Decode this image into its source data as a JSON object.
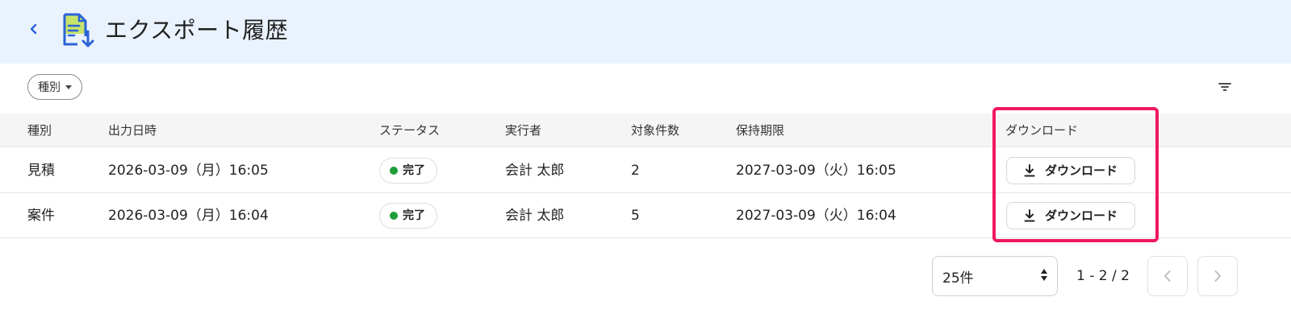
{
  "header": {
    "title": "エクスポート履歴",
    "back_icon": "chevron-left-icon",
    "page_icon": "document-download-icon"
  },
  "filter_chip": {
    "label": "種別"
  },
  "columns": [
    "種別",
    "出力日時",
    "ステータス",
    "実行者",
    "対象件数",
    "保持期限",
    "ダウンロード"
  ],
  "rows": [
    {
      "type": "見積",
      "output_datetime": "2026-03-09（月）16:05",
      "status": "完了",
      "executor": "会計 太郎",
      "count": "2",
      "retention": "2027-03-09（火）16:05",
      "download_label": "ダウンロード"
    },
    {
      "type": "案件",
      "output_datetime": "2026-03-09（月）16:04",
      "status": "完了",
      "executor": "会計 太郎",
      "count": "5",
      "retention": "2027-03-09（火）16:04",
      "download_label": "ダウンロード"
    }
  ],
  "pagination": {
    "per_page": "25件",
    "range": "1 - 2 / 2"
  },
  "colors": {
    "header_bg": "#eaf2fd",
    "highlight": "#f0185e",
    "status_dot": "#1e9e3a",
    "icon_blue": "#2b63d9",
    "icon_green": "#c6e36b"
  }
}
